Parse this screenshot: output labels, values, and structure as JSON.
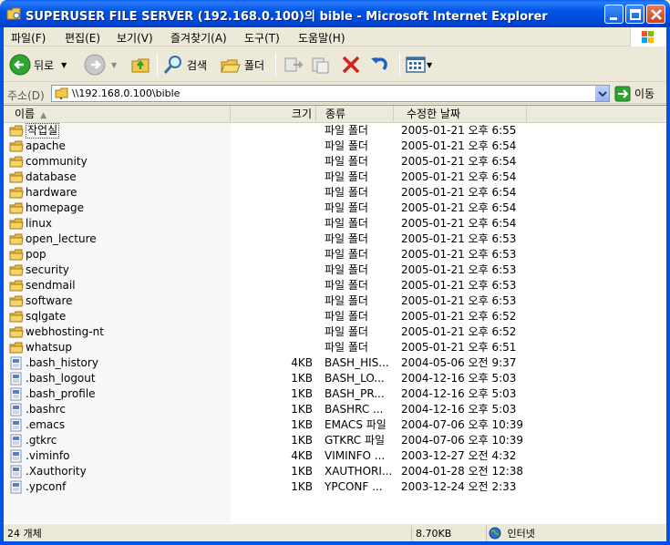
{
  "window": {
    "title": "SUPERUSER FILE SERVER (192.168.0.100)의 bible - Microsoft Internet Explorer"
  },
  "menu": [
    {
      "label": "파일(F)"
    },
    {
      "label": "편집(E)"
    },
    {
      "label": "보기(V)"
    },
    {
      "label": "즐겨찾기(A)"
    },
    {
      "label": "도구(T)"
    },
    {
      "label": "도움말(H)"
    }
  ],
  "toolbar": {
    "back_label": "뒤로",
    "search_label": "검색",
    "folders_label": "폴더"
  },
  "address": {
    "label": "주소(D)",
    "value": "\\\\192.168.0.100\\bible",
    "go_label": "이동"
  },
  "columns": {
    "name": "이름",
    "size": "크기",
    "type": "종류",
    "modified": "수정한 날짜"
  },
  "files": [
    {
      "name": "작업실",
      "size": "",
      "type": "파일 폴더",
      "modified": "2005-01-21 오후 6:55",
      "kind": "folder"
    },
    {
      "name": "apache",
      "size": "",
      "type": "파일 폴더",
      "modified": "2005-01-21 오후 6:54",
      "kind": "folder"
    },
    {
      "name": "community",
      "size": "",
      "type": "파일 폴더",
      "modified": "2005-01-21 오후 6:54",
      "kind": "folder"
    },
    {
      "name": "database",
      "size": "",
      "type": "파일 폴더",
      "modified": "2005-01-21 오후 6:54",
      "kind": "folder"
    },
    {
      "name": "hardware",
      "size": "",
      "type": "파일 폴더",
      "modified": "2005-01-21 오후 6:54",
      "kind": "folder"
    },
    {
      "name": "homepage",
      "size": "",
      "type": "파일 폴더",
      "modified": "2005-01-21 오후 6:54",
      "kind": "folder"
    },
    {
      "name": "linux",
      "size": "",
      "type": "파일 폴더",
      "modified": "2005-01-21 오후 6:54",
      "kind": "folder"
    },
    {
      "name": "open_lecture",
      "size": "",
      "type": "파일 폴더",
      "modified": "2005-01-21 오후 6:53",
      "kind": "folder"
    },
    {
      "name": "pop",
      "size": "",
      "type": "파일 폴더",
      "modified": "2005-01-21 오후 6:53",
      "kind": "folder"
    },
    {
      "name": "security",
      "size": "",
      "type": "파일 폴더",
      "modified": "2005-01-21 오후 6:53",
      "kind": "folder"
    },
    {
      "name": "sendmail",
      "size": "",
      "type": "파일 폴더",
      "modified": "2005-01-21 오후 6:53",
      "kind": "folder"
    },
    {
      "name": "software",
      "size": "",
      "type": "파일 폴더",
      "modified": "2005-01-21 오후 6:53",
      "kind": "folder"
    },
    {
      "name": "sqlgate",
      "size": "",
      "type": "파일 폴더",
      "modified": "2005-01-21 오후 6:52",
      "kind": "folder"
    },
    {
      "name": "webhosting-nt",
      "size": "",
      "type": "파일 폴더",
      "modified": "2005-01-21 오후 6:52",
      "kind": "folder"
    },
    {
      "name": "whatsup",
      "size": "",
      "type": "파일 폴더",
      "modified": "2005-01-21 오후 6:51",
      "kind": "folder"
    },
    {
      "name": ".bash_history",
      "size": "4KB",
      "type": "BASH_HIS...",
      "modified": "2004-05-06 오전 9:37",
      "kind": "file"
    },
    {
      "name": ".bash_logout",
      "size": "1KB",
      "type": "BASH_LO...",
      "modified": "2004-12-16 오후 5:03",
      "kind": "file"
    },
    {
      "name": ".bash_profile",
      "size": "1KB",
      "type": "BASH_PR...",
      "modified": "2004-12-16 오후 5:03",
      "kind": "file"
    },
    {
      "name": ".bashrc",
      "size": "1KB",
      "type": "BASHRC ...",
      "modified": "2004-12-16 오후 5:03",
      "kind": "file"
    },
    {
      "name": ".emacs",
      "size": "1KB",
      "type": "EMACS 파일",
      "modified": "2004-07-06 오후 10:39",
      "kind": "file"
    },
    {
      "name": ".gtkrc",
      "size": "1KB",
      "type": "GTKRC 파일",
      "modified": "2004-07-06 오후 10:39",
      "kind": "file"
    },
    {
      "name": ".viminfo",
      "size": "4KB",
      "type": "VIMINFO ...",
      "modified": "2003-12-27 오전 4:32",
      "kind": "file"
    },
    {
      "name": ".Xauthority",
      "size": "1KB",
      "type": "XAUTHORI...",
      "modified": "2004-01-28 오전 12:38",
      "kind": "file"
    },
    {
      "name": ".ypconf",
      "size": "1KB",
      "type": "YPCONF ...",
      "modified": "2003-12-24 오전 2:33",
      "kind": "file"
    }
  ],
  "status": {
    "count": "24 개체",
    "size": "8.70KB",
    "zone": "인터넷"
  },
  "colors": {
    "titlebar": "#0054E3",
    "chrome": "#ECE9D8",
    "folder": "#F5D36B"
  }
}
